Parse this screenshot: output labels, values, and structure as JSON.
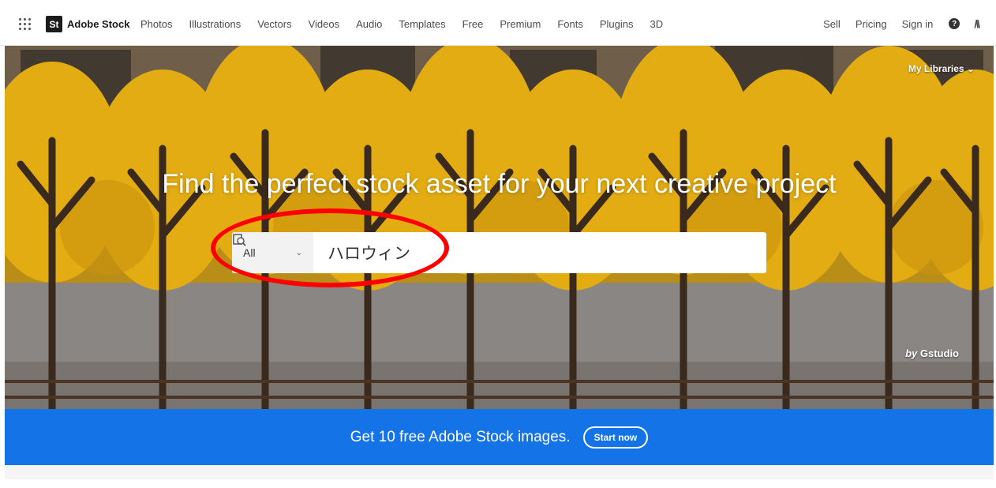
{
  "nav": {
    "brand": "Adobe Stock",
    "brand_badge": "St",
    "items": [
      "Photos",
      "Illustrations",
      "Vectors",
      "Videos",
      "Audio",
      "Templates",
      "Free",
      "Premium",
      "Fonts",
      "Plugins",
      "3D"
    ],
    "right": {
      "sell": "Sell",
      "pricing": "Pricing",
      "signin": "Sign in",
      "help": "?",
      "adobe": "/\\\\"
    }
  },
  "hero": {
    "libraries": "My Libraries ⌄",
    "headline": "Find the perfect stock asset for your next creative project",
    "search": {
      "category": "All",
      "query": "ハロウィン"
    },
    "credit_by": "by",
    "credit_name": "Gstudio"
  },
  "promo": {
    "text": "Get 10 free Adobe Stock images.",
    "button": "Start now"
  },
  "colors": {
    "accent": "#1473e6",
    "annotation": "#ff0000"
  }
}
